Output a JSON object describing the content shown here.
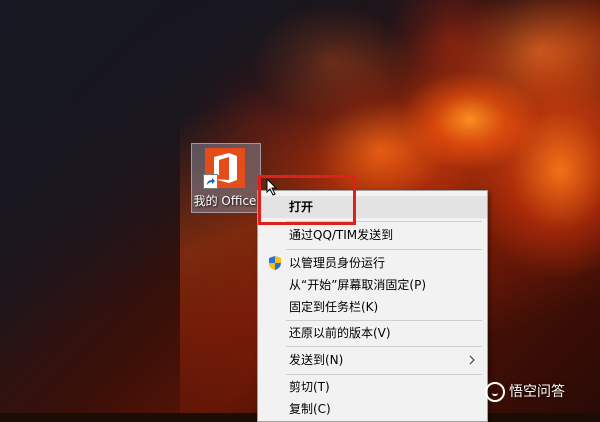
{
  "desktop": {
    "icon": {
      "label": "我的 Office",
      "icon": "office-logo-icon",
      "badge": "shortcut-arrow-icon"
    }
  },
  "context_menu": {
    "items": [
      {
        "label": "打开",
        "default": true
      },
      {
        "label": "通过QQ/TIM发送到"
      },
      {
        "label": "以管理员身份运行",
        "icon": "uac-shield-icon"
      },
      {
        "label": "从“开始”屏幕取消固定(P)"
      },
      {
        "label": "固定到任务栏(K)"
      },
      {
        "label": "还原以前的版本(V)"
      },
      {
        "label": "发送到(N)",
        "submenu": true
      },
      {
        "label": "剪切(T)"
      },
      {
        "label": "复制(C)"
      }
    ]
  },
  "highlight": {
    "color": "#e0201c"
  },
  "watermark": {
    "text": "悟空问答"
  },
  "colors": {
    "menu_bg": "#f2f2f2",
    "menu_hover": "#e3e3e3",
    "office_orange": "#e44d1a"
  }
}
